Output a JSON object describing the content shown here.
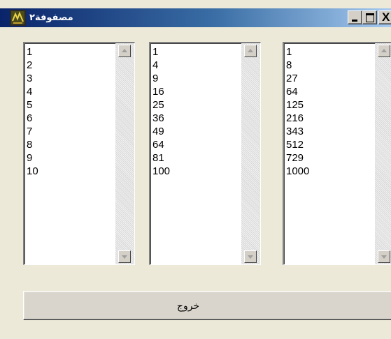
{
  "window": {
    "title": "مصفوفة٢",
    "controls": [
      "minimize",
      "maximize",
      "close"
    ],
    "close_glyph": "X"
  },
  "lists": [
    {
      "items": [
        "1",
        "2",
        "3",
        "4",
        "5",
        "6",
        "7",
        "8",
        "9",
        "10"
      ]
    },
    {
      "items": [
        "1",
        "4",
        "9",
        "16",
        "25",
        "36",
        "49",
        "64",
        "81",
        "100"
      ]
    },
    {
      "items": [
        "1",
        "8",
        "27",
        "64",
        "125",
        "216",
        "343",
        "512",
        "729",
        "1000"
      ]
    }
  ],
  "exit_button": {
    "label": "خروج"
  },
  "icons": {
    "app": "app-window-icon",
    "scroll_up": "scroll-up-arrow-icon",
    "scroll_down": "scroll-down-arrow-icon"
  },
  "colors": {
    "titlebar_start": "#0a246a",
    "titlebar_end": "#a6caf0",
    "face": "#ece9d8"
  }
}
